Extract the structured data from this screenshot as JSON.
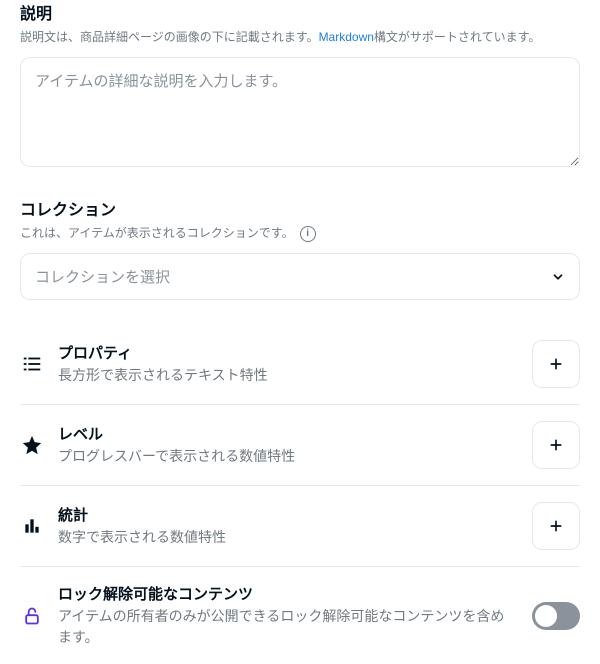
{
  "description": {
    "label": "説明",
    "hint_before": "説明文は、商品詳細ページの画像の下に記載されます。",
    "markdown_link": "Markdown",
    "hint_after": " 構文がサポートされています。",
    "placeholder": "アイテムの詳細な説明を入力します。"
  },
  "collection": {
    "label": "コレクション",
    "hint": "これは、アイテムが表示されるコレクションです。",
    "placeholder": "コレクションを選択"
  },
  "traits": {
    "properties": {
      "title": "プロパティ",
      "desc": "長方形で表示されるテキスト特性"
    },
    "levels": {
      "title": "レベル",
      "desc": "プログレスバーで表示される数値特性"
    },
    "stats": {
      "title": "統計",
      "desc": "数字で表示される数値特性"
    },
    "unlockable": {
      "title": "ロック解除可能なコンテンツ",
      "desc": "アイテムの所有者のみが公開できるロック解除可能なコンテンツを含めます。"
    }
  }
}
